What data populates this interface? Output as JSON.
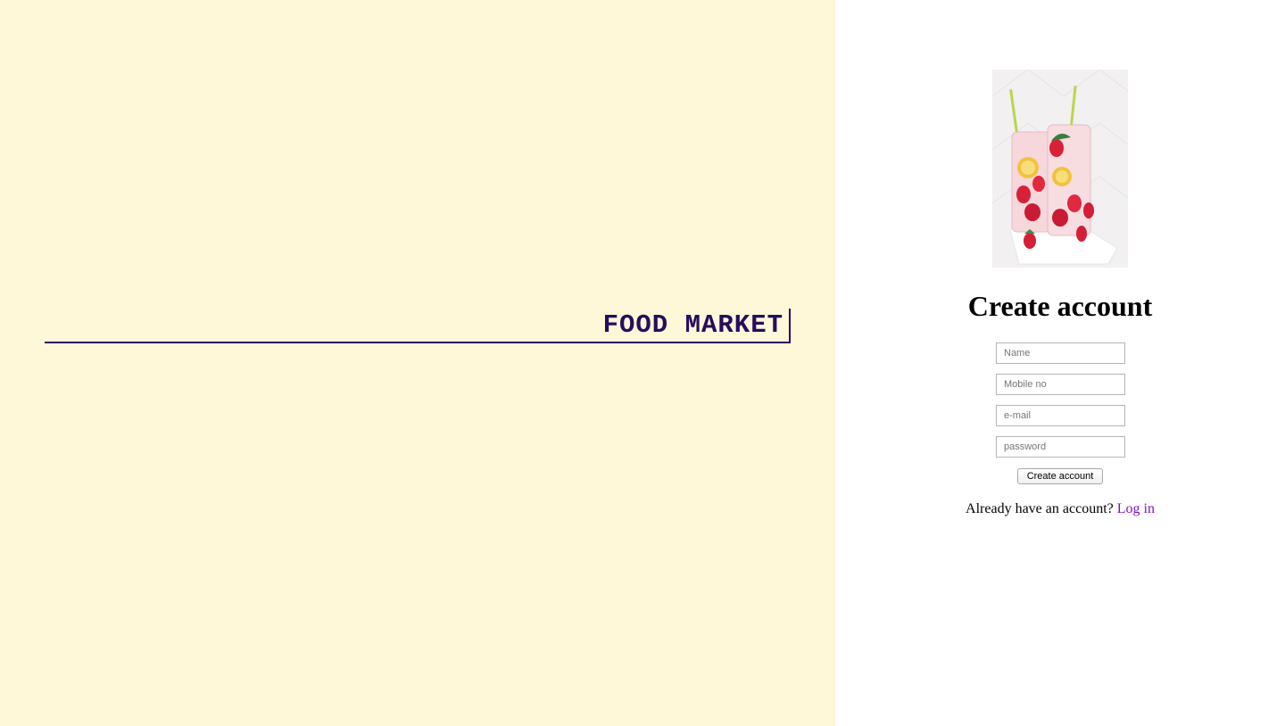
{
  "brand": {
    "title": "FOOD MARKET",
    "color": "#2a0b5e",
    "background": "#fef8d8"
  },
  "hero": {
    "description_icon": "drinks-image"
  },
  "form": {
    "title": "Create account",
    "fields": {
      "name_placeholder": "Name",
      "mobile_placeholder": "Mobile no",
      "email_placeholder": "e-mail",
      "password_placeholder": "password"
    },
    "submit_label": "Create account"
  },
  "login": {
    "prompt": "Already have an account?",
    "link_label": "Log in",
    "link_color": "#7f12c4"
  }
}
